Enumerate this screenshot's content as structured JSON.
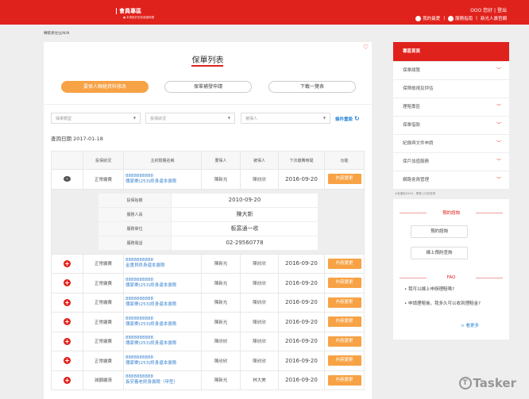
{
  "header": {
    "section_title": "會員專區",
    "subtitle": "● 本專區於週末維護時間",
    "greeting": "OOO 您好",
    "logout": "登出",
    "favorites": "我的最愛",
    "service_guide": "服務指南",
    "official_site": "新光人壽官網"
  },
  "breadcrumb": "轉帳異住址/N/N",
  "page": {
    "title": "保單列表",
    "buttons": [
      "要保人聯絡資料修改",
      "保單補發申請",
      "下載一覽表"
    ],
    "filters": [
      {
        "placeholder": "保單類型"
      },
      {
        "placeholder": "投保狀況"
      },
      {
        "placeholder": "被保人"
      }
    ],
    "reset": "條件重設",
    "reset_icon": "refresh-icon",
    "query_date": "查詢日期 2017-01-18"
  },
  "table": {
    "headers": [
      "",
      "投保狀況",
      "主約險種名稱",
      "要保人",
      "被保人",
      "下次繳費時間",
      "功能"
    ],
    "expanded_row": {
      "status": "正常繳費",
      "policy_no": "8888888888",
      "name": "傳家樂(253)終身還本壽險",
      "holder": "陳新光",
      "insured": "陳欣欣",
      "next_pay": "2016-09-20",
      "action": "內容變更",
      "details": [
        {
          "k": "投保始期",
          "v": "2010-09-20"
        },
        {
          "k": "服務人員",
          "v": "陳大新"
        },
        {
          "k": "服務單位",
          "v": "板富通一收"
        },
        {
          "k": "服務電話",
          "v": "02-29560778"
        }
      ]
    },
    "rows": [
      {
        "status": "正常繳費",
        "policy_no": "8888888888",
        "name": "金寶貝終身還本壽險",
        "holder": "陳新光",
        "insured": "陳欣欣",
        "next_pay": "2016-09-20",
        "action": "內容變更"
      },
      {
        "status": "正常繳費",
        "policy_no": "8888888888",
        "name": "傳家樂(253)終身還本壽險",
        "holder": "陳新光",
        "insured": "陳欣欣",
        "next_pay": "2016-09-20",
        "action": "內容變更"
      },
      {
        "status": "正常繳費",
        "policy_no": "8888888888",
        "name": "傳家樂(253)終身還本壽險",
        "holder": "陳新光",
        "insured": "陳欣欣",
        "next_pay": "2016-09-20",
        "action": "內容變更"
      },
      {
        "status": "正常繳費",
        "policy_no": "8888888888",
        "name": "傳家樂(253)終身還本壽險",
        "holder": "陳新光",
        "insured": "陳欣欣",
        "next_pay": "2016-09-20",
        "action": "內容變更"
      },
      {
        "status": "正常繳費",
        "policy_no": "8888888888",
        "name": "傳家樂(253)終身還本壽險",
        "holder": "陳欣欣",
        "insured": "陳欣欣",
        "next_pay": "2016-09-20",
        "action": "內容變更"
      },
      {
        "status": "正常繳費",
        "policy_no": "8888888888",
        "name": "傳家樂(253)終身還本壽險",
        "holder": "陳欣欣",
        "insured": "陳欣欣",
        "next_pay": "2016-09-20",
        "action": "內容變更"
      },
      {
        "status": "減額繳清",
        "policy_no": "8888888888",
        "name": "長安養老終身壽險（甲型）",
        "holder": "陳新光",
        "insured": "林大美",
        "next_pay": "2016-09-20",
        "action": "內容變更"
      }
    ]
  },
  "sidebar": {
    "home": "專區首頁",
    "items": [
      {
        "label": "保單總覽",
        "chev": true
      },
      {
        "label": "保障檢視及評估",
        "chev": false
      },
      {
        "label": "理賠專區",
        "chev": true
      },
      {
        "label": "保單借款",
        "chev": true
      },
      {
        "label": "紀錄與文件申請",
        "chev": true
      },
      {
        "label": "保戶加值服務",
        "chev": true
      },
      {
        "label": "網路會員管理",
        "chev": true
      }
    ],
    "note": "★為連結XXXX，需登入內容查詢",
    "booking": {
      "title": "預約諮詢",
      "buttons": [
        "預約諮詢",
        "線上預約查詢"
      ]
    },
    "faq": {
      "title": "FAQ",
      "items": [
        "我可以線上申辦理賠嗎?",
        "申請理賠後，我多久可以收到理賠金?"
      ],
      "more": "> 看更多"
    }
  },
  "watermark": "Tasker",
  "colors": {
    "brand": "#e0221c",
    "accent": "#f7a245",
    "link": "#3b84d0"
  }
}
